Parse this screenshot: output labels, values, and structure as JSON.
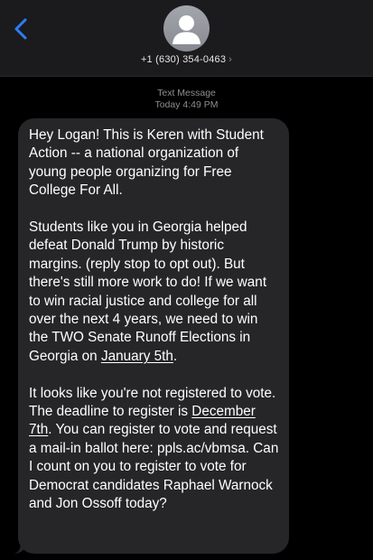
{
  "header": {
    "back_icon": "chevron-left-icon",
    "avatar_icon": "person-silhouette-icon",
    "contact_number": "+1 (630) 354-0463",
    "contact_chevron": "›",
    "accent_color": "#2f7cf6"
  },
  "thread": {
    "message_type": "Text Message",
    "timestamp": "Today 4:49 PM"
  },
  "message": {
    "p1": "Hey Logan! This is Keren with Student Action -- a national organization of young people organizing for Free College For All.",
    "p2_text": "Students like you in Georgia helped defeat Donald Trump by historic margins. (reply stop to opt out). But there's still more work to do! If we want to win racial justice and college for all over the next 4 years, we need to win the TWO Senate Runoff Elections in Georgia on ",
    "p2_link": "January 5th",
    "p2_end": ".",
    "p3_text": "It looks like you're not registered to vote. The deadline to register is ",
    "p3_link": "December 7th",
    "p3_end": ". You can register to vote and request a mail-in ballot here: ppls.ac/vbmsa. Can I count on you to register to vote for Democrat candidates Raphael Warnock and Jon Ossoff today?",
    "bubble_color": "#262629"
  }
}
